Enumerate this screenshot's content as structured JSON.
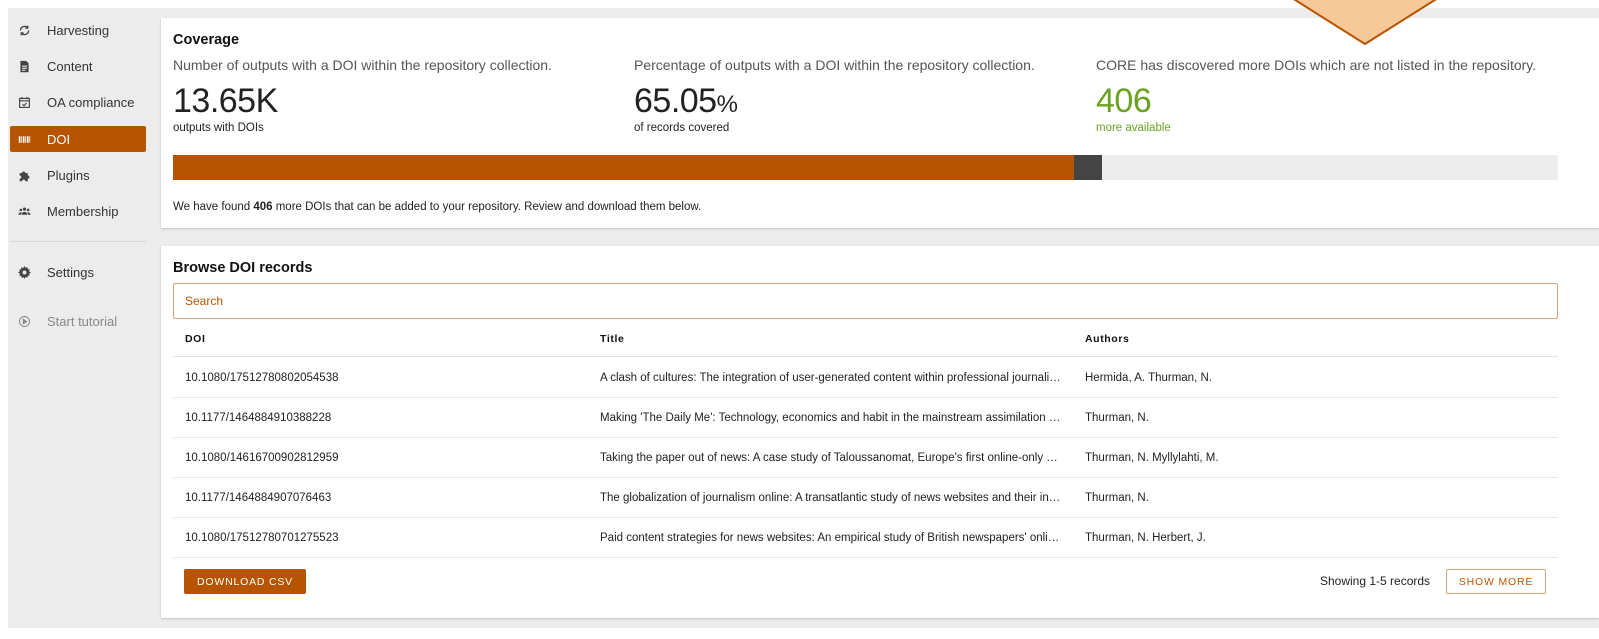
{
  "sidebar": {
    "items": [
      {
        "label": "Harvesting",
        "icon": "refresh-icon"
      },
      {
        "label": "Content",
        "icon": "document-icon"
      },
      {
        "label": "OA compliance",
        "icon": "calendar-check-icon"
      },
      {
        "label": "DOI",
        "icon": "barcode-icon"
      },
      {
        "label": "Plugins",
        "icon": "puzzle-icon"
      },
      {
        "label": "Membership",
        "icon": "users-icon"
      }
    ],
    "settings": {
      "label": "Settings",
      "icon": "gear-icon"
    },
    "tutorial": {
      "label": "Start tutorial",
      "icon": "play-circle-icon"
    },
    "active_item": "DOI"
  },
  "coverage": {
    "title": "Coverage",
    "stats": [
      {
        "description": "Number of outputs with a DOI within the repository collection.",
        "value": "13.65K",
        "caption": "outputs with DOIs"
      },
      {
        "description": "Percentage of outputs with a DOI within the repository collection.",
        "value": "65.05",
        "unit": "%",
        "caption": "of records covered"
      },
      {
        "description": "CORE has discovered more DOIs which are not listed in the repository.",
        "value": "406",
        "caption": "more available"
      }
    ],
    "progress": {
      "covered_percent": 65.05,
      "extra_percent": 2.0
    },
    "found": {
      "prefix": "We have found ",
      "count": "406",
      "suffix": " more DOIs that can be added to your repository. Review and download them below."
    }
  },
  "browse": {
    "title": "Browse DOI records",
    "search_placeholder": "Search",
    "columns": {
      "doi": "DOI",
      "title": "Title",
      "authors": "Authors"
    },
    "rows": [
      {
        "doi": "10.1080/17512780802054538",
        "title": "A clash of cultures: The integration of user-generated content within professional journalistic frameworks at British newspaper websites",
        "authors": "Hermida, A. Thurman, N."
      },
      {
        "doi": "10.1177/1464884910388228",
        "title": "Making 'The Daily Me': Technology, economics and habit in the mainstream assimilation of personalized news",
        "authors": "Thurman, N."
      },
      {
        "doi": "10.1080/14616700902812959",
        "title": "Taking the paper out of news: A case study of Taloussanomat, Europe's first online-only newspaper",
        "authors": "Thurman, N. Myllylahti, M."
      },
      {
        "doi": "10.1177/1464884907076463",
        "title": "The globalization of journalism online: A transatlantic study of news websites and their international readers",
        "authors": "Thurman, N."
      },
      {
        "doi": "10.1080/17512780701275523",
        "title": "Paid content strategies for news websites: An empirical study of British newspapers' online business models",
        "authors": "Thurman, N. Herbert, J."
      }
    ],
    "download_label": "DOWNLOAD CSV",
    "showing_text": "Showing 1-5 records",
    "show_more_label": "SHOW MORE"
  },
  "colors": {
    "accent": "#b75400",
    "green": "#6aa321",
    "callout_fill": "#f6c89a",
    "callout_stroke": "#b75400"
  }
}
